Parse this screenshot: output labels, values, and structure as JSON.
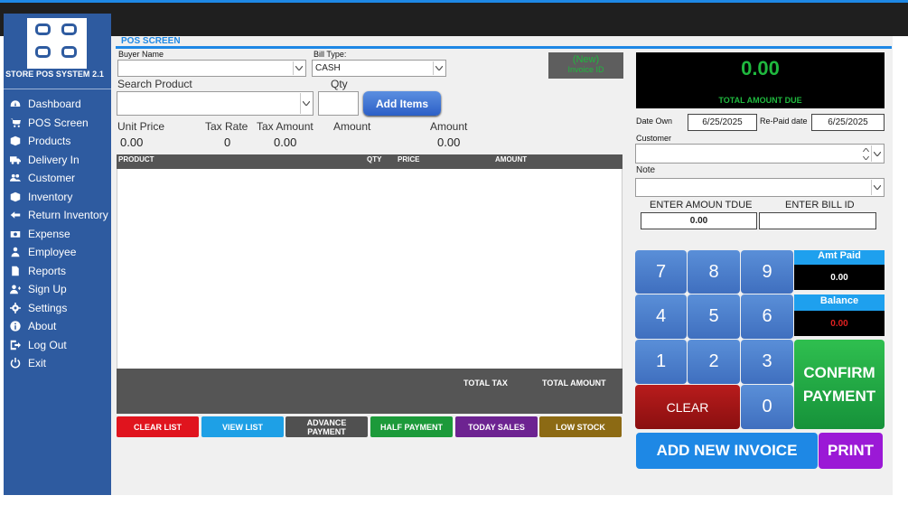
{
  "app": {
    "brand": "STORE POS SYSTEM 2.1",
    "screen_title": "POS SCREEN",
    "accent": "#1e88e5",
    "sidebar_color": "#2e5ba0"
  },
  "sidebar": {
    "items": [
      {
        "label": "Dashboard",
        "icon": "dashboard-icon"
      },
      {
        "label": "POS Screen",
        "icon": "cart-icon"
      },
      {
        "label": "Products",
        "icon": "box-icon"
      },
      {
        "label": "Delivery In",
        "icon": "truck-icon"
      },
      {
        "label": "Customer",
        "icon": "users-icon"
      },
      {
        "label": "Inventory",
        "icon": "box-icon"
      },
      {
        "label": "Return Inventory",
        "icon": "return-icon"
      },
      {
        "label": "Expense",
        "icon": "money-icon"
      },
      {
        "label": "Employee",
        "icon": "user-tie-icon"
      },
      {
        "label": "Reports",
        "icon": "document-icon"
      },
      {
        "label": "Sign Up",
        "icon": "user-add-icon"
      },
      {
        "label": "Settings",
        "icon": "gear-icon"
      },
      {
        "label": "About",
        "icon": "info-icon"
      },
      {
        "label": "Log Out",
        "icon": "logout-icon"
      },
      {
        "label": "Exit",
        "icon": "power-icon"
      }
    ]
  },
  "form": {
    "buyer_name_label": "Buyer Name",
    "buyer_name_value": "",
    "bill_type_label": "Bill Type:",
    "bill_type_value": "CASH",
    "search_product_label": "Search Product",
    "search_product_value": "",
    "qty_label": "Qty",
    "qty_value": "",
    "add_items_label": "Add Items",
    "invoice_new": "(New)",
    "invoice_id_label": "Invoice ID",
    "unit_price_label": "Unit Price",
    "unit_price_value": "0.00",
    "tax_rate_label": "Tax Rate",
    "tax_rate_value": "0",
    "tax_amount_label": "Tax Amount",
    "tax_amount_value": "0.00",
    "amount_label_1": "Amount",
    "amount_label_2": "Amount",
    "amount_value": "0.00"
  },
  "grid": {
    "columns": [
      "PRODUCT",
      "QTY",
      "PRICE",
      "AMOUNT"
    ],
    "rows": [],
    "footer_total_tax": "TOTAL TAX",
    "footer_total_amount": "TOTAL AMOUNT"
  },
  "actions": {
    "clear_list": "CLEAR LIST",
    "view_list": "VIEW LIST",
    "advance_payment_1": "ADVANCE",
    "advance_payment_2": "PAYMENT",
    "half_payment": "HALF PAYMENT",
    "today_sales": "TODAY SALES",
    "low_stock": "LOW STOCK"
  },
  "payment": {
    "total_amount": "0.00",
    "total_amount_label": "TOTAL AMOUNT DUE",
    "date_own_label": "Date Own",
    "date_own_value": "6/25/2025",
    "repaid_date_label": "Re-Paid date",
    "repaid_date_value": "6/25/2025",
    "customer_label": "Customer",
    "customer_value": "",
    "note_label": "Note",
    "note_value": "",
    "enter_amount_due_label": "ENTER AMOUN TDUE",
    "enter_amount_due_value": "0.00",
    "enter_bill_id_label": "ENTER BILL ID",
    "enter_bill_id_value": "",
    "amt_paid_label": "Amt Paid",
    "amt_paid_value": "0.00",
    "balance_label": "Balance",
    "balance_value": "0.00",
    "confirm_payment_1": "CONFIRM",
    "confirm_payment_2": "PAYMENT",
    "clear_label": "CLEAR",
    "add_new_invoice": "ADD NEW INVOICE",
    "print": "PRINT"
  },
  "keypad": {
    "keys": [
      "7",
      "8",
      "9",
      "4",
      "5",
      "6",
      "1",
      "2",
      "3",
      "0"
    ]
  }
}
